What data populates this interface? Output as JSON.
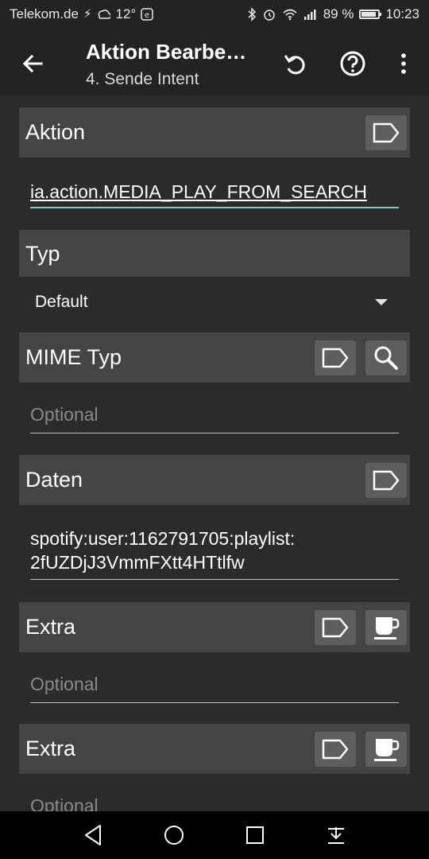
{
  "status_bar": {
    "carrier": "Telekom.de",
    "temperature": "12°",
    "battery_percent": "89 %",
    "battery_level": 0.89,
    "time": "10:23"
  },
  "app_bar": {
    "title": "Aktion Bearbe…",
    "subtitle": "4. Sende Intent",
    "icons": [
      "back-arrow-icon",
      "undo-icon",
      "help-icon",
      "more-vert-icon"
    ]
  },
  "sections": {
    "aktion": {
      "label": "Aktion",
      "value": "ia.action.MEDIA_PLAY_FROM_SEARCH"
    },
    "typ": {
      "label": "Typ",
      "selected": "Default"
    },
    "mime": {
      "label": "MIME Typ",
      "placeholder": "Optional"
    },
    "daten": {
      "label": "Daten",
      "value_line1": "spotify:user:1162791705:playlist:",
      "value_line2": "2fUZDjJ3VmmFXtt4HTtlfw"
    },
    "extra1": {
      "label": "Extra",
      "placeholder": "Optional"
    },
    "extra2": {
      "label": "Extra",
      "placeholder": "Optional"
    }
  },
  "colors": {
    "background": "#2b2b2b",
    "header": "#444444",
    "accent_underline": "#80cbc4"
  }
}
